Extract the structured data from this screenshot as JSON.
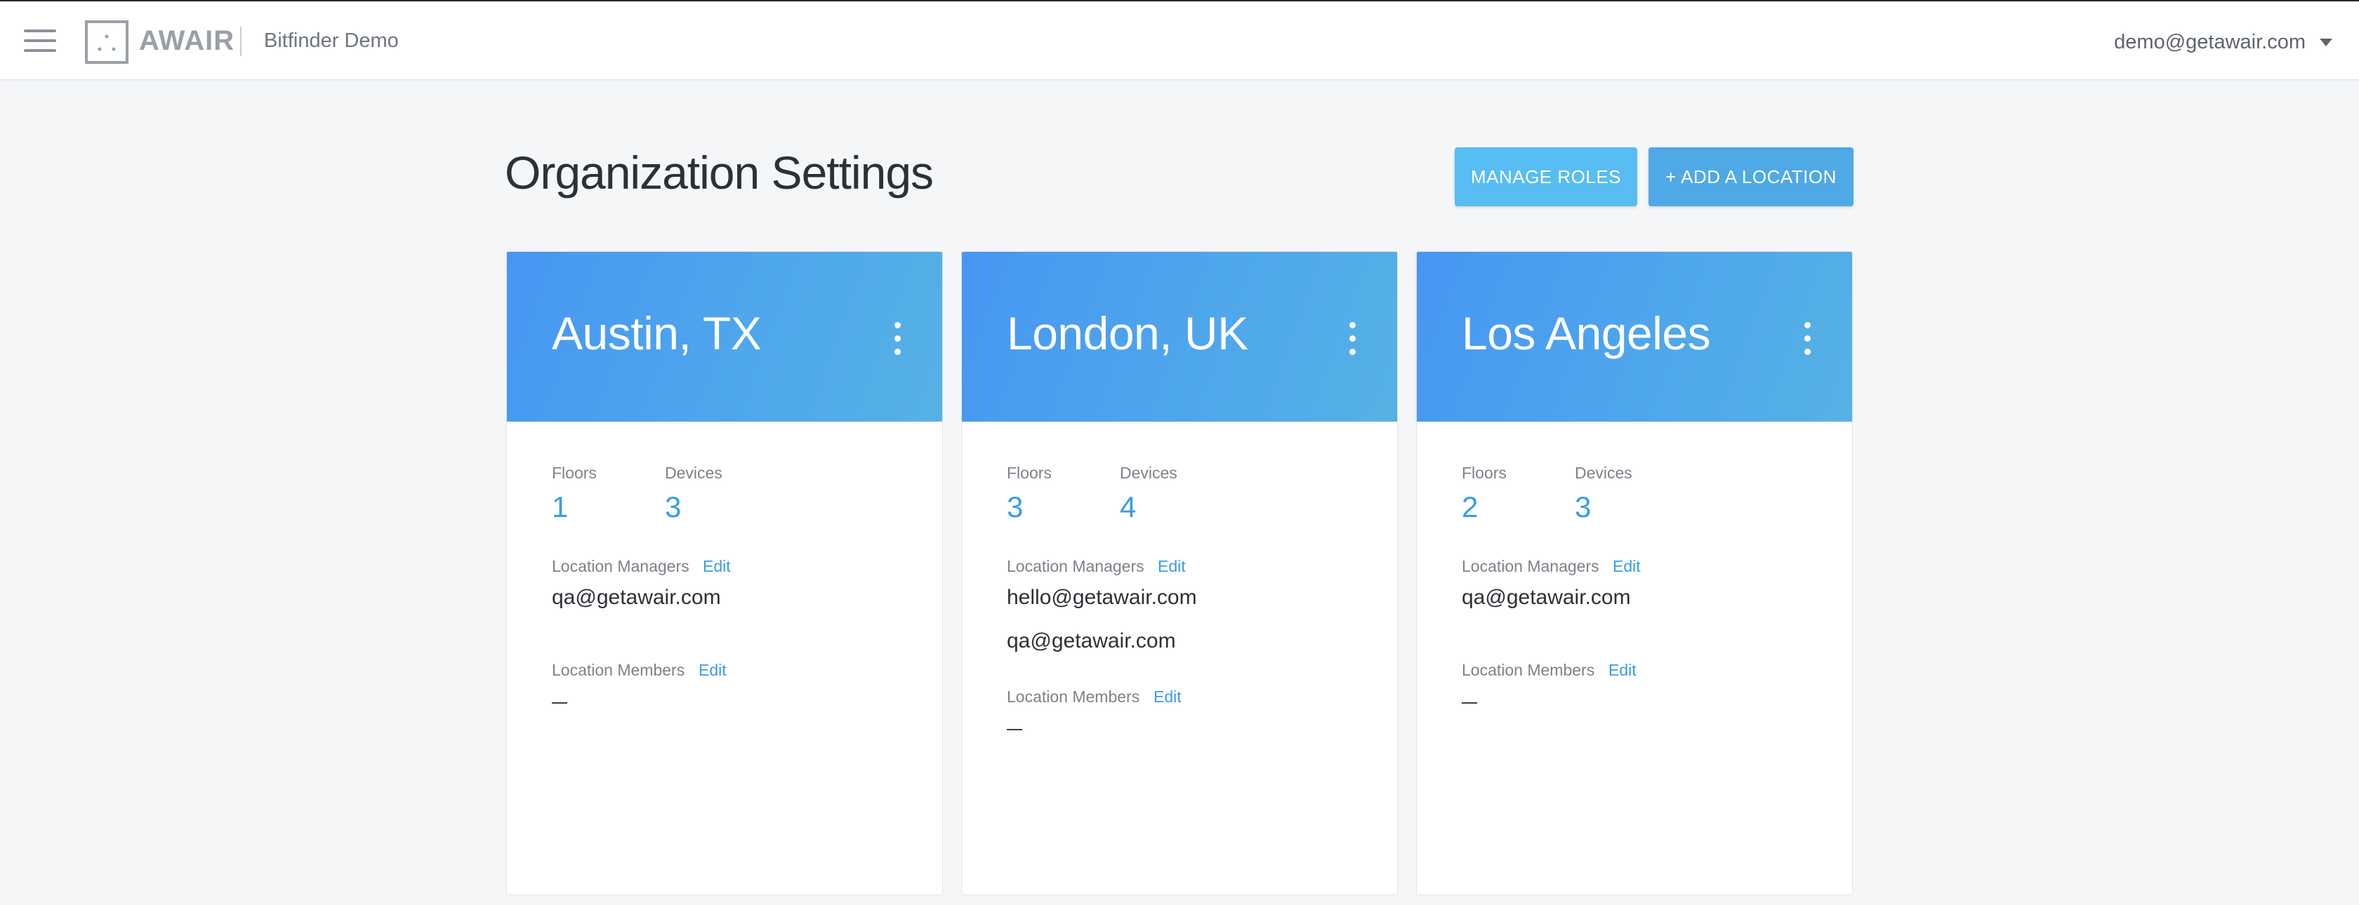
{
  "header": {
    "logo_text": "AWAIR",
    "org_name": "Bitfinder Demo",
    "user_email": "demo@getawair.com"
  },
  "page": {
    "title": "Organization Settings",
    "manage_roles_label": "MANAGE ROLES",
    "add_location_label": "+ ADD A LOCATION"
  },
  "labels": {
    "floors": "Floors",
    "devices": "Devices",
    "location_managers": "Location Managers",
    "location_members": "Location Members",
    "edit": "Edit",
    "empty": "—"
  },
  "locations": [
    {
      "name": "Austin, TX",
      "floors": "1",
      "devices": "3",
      "managers": [
        "qa@getawair.com"
      ],
      "members": "—"
    },
    {
      "name": "London, UK",
      "floors": "3",
      "devices": "4",
      "managers": [
        "hello@getawair.com",
        "qa@getawair.com"
      ],
      "members": "—"
    },
    {
      "name": "Los Angeles",
      "floors": "2",
      "devices": "3",
      "managers": [
        "qa@getawair.com"
      ],
      "members": "—"
    }
  ],
  "colors": {
    "accent": "#3a9de3",
    "manage_roles_button": "#57bdf2",
    "add_location_button": "#4fa9e6",
    "card_header_start": "#4796f4",
    "card_header_end": "#56b1e4"
  }
}
